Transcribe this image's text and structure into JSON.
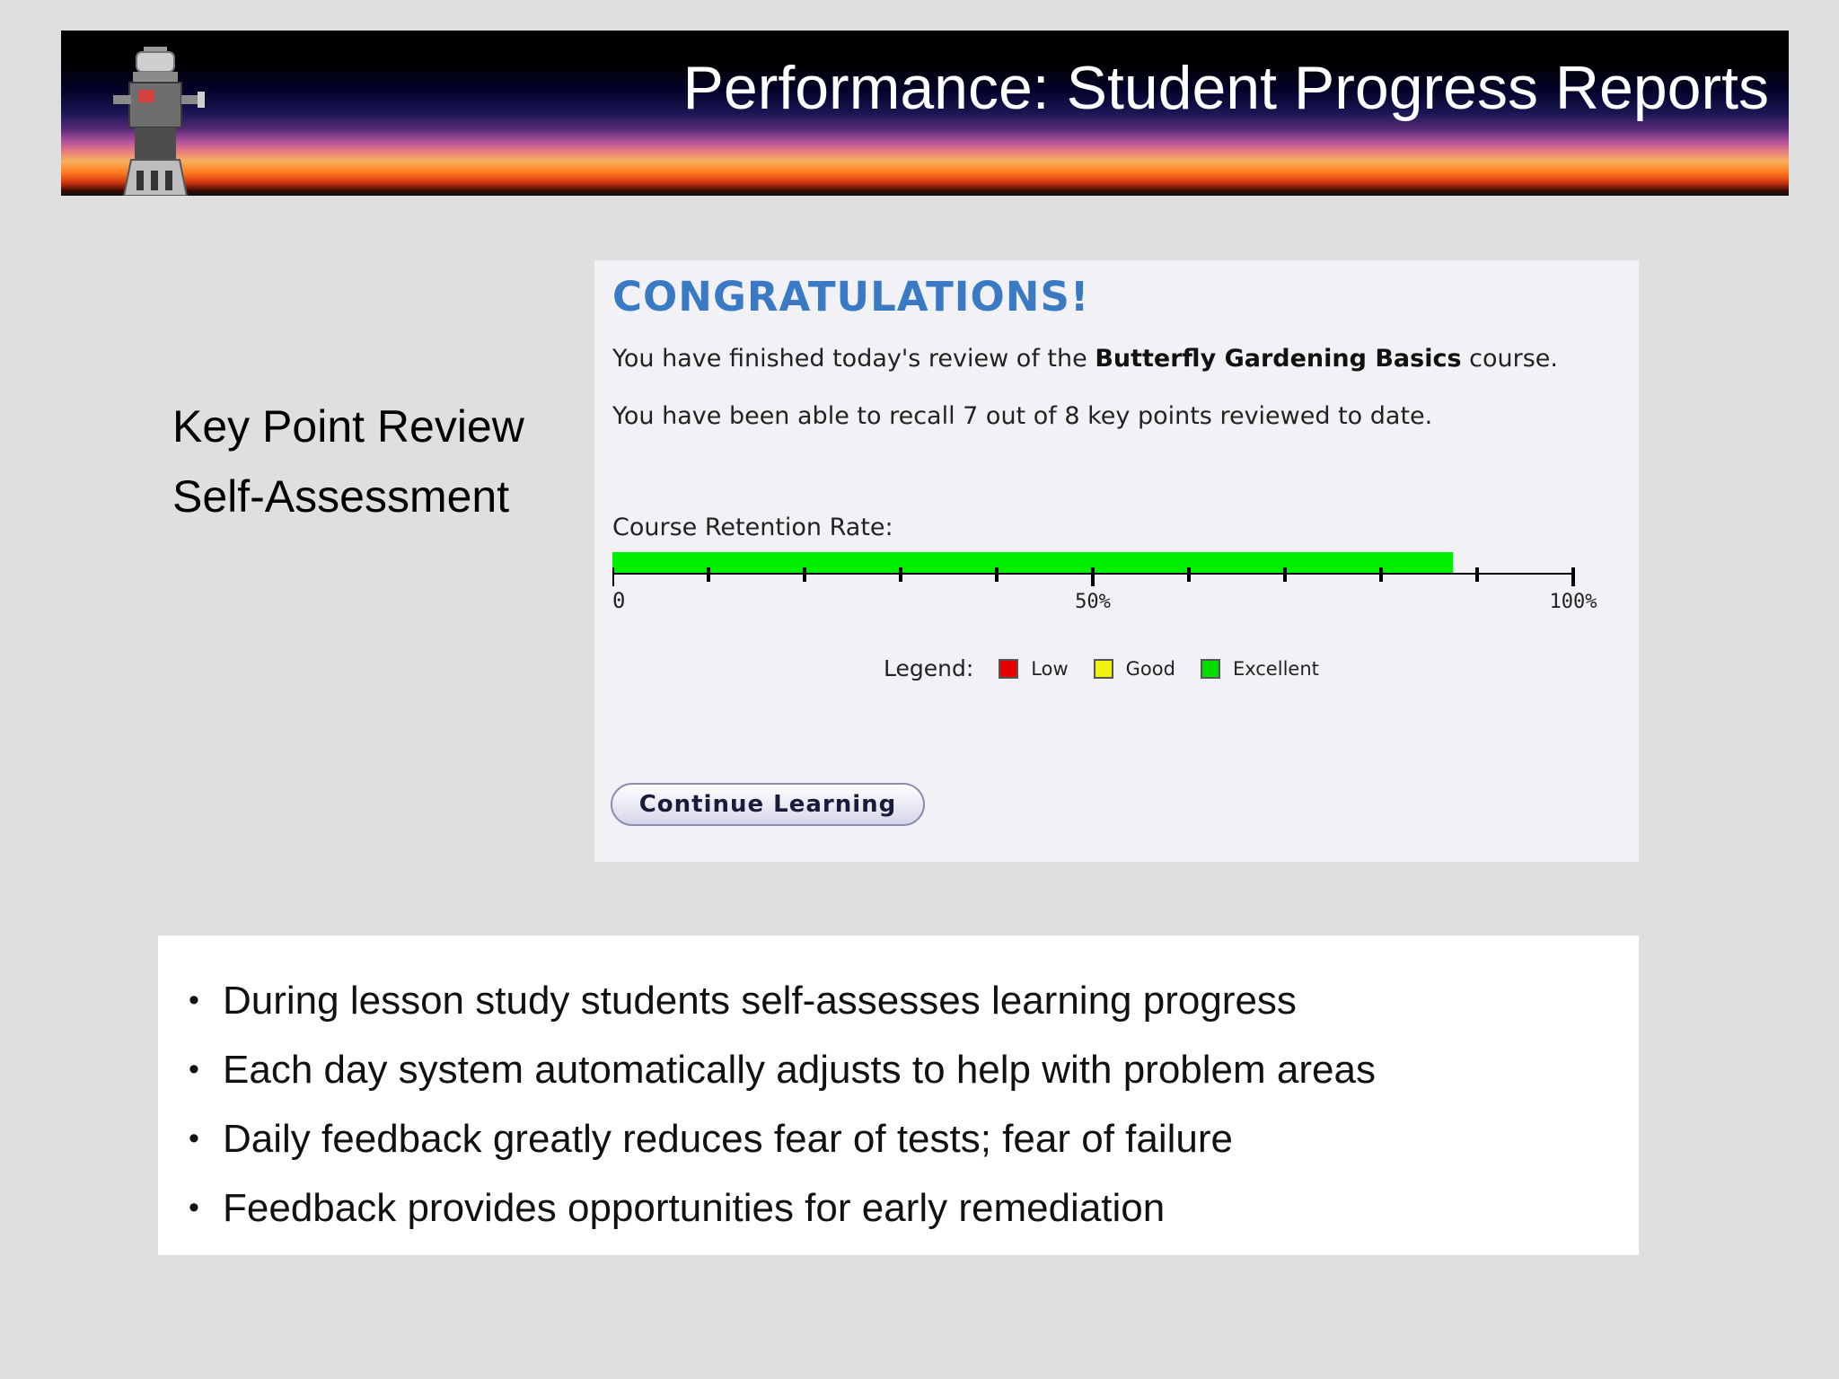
{
  "header": {
    "title": "Performance: Student Progress Reports"
  },
  "side_labels": {
    "line1": "Key Point Review",
    "line2": "Self-Assessment"
  },
  "panel": {
    "heading": "CONGRATULATIONS!",
    "finished_prefix": "You have finished today's review of the ",
    "course_name": "Butterfly Gardening Basics",
    "finished_suffix": " course.",
    "recall_text": "You have been able to recall 7 out of 8 key points reviewed to date.",
    "retention_label": "Course Retention Rate:",
    "retention_rate": 0.875,
    "bar_color": "#00ee00",
    "scale_labels": {
      "min": "0",
      "mid": "50%",
      "max": "100%"
    },
    "legend": {
      "label": "Legend:",
      "items": [
        {
          "label": "Low",
          "color": "#e60000"
        },
        {
          "label": "Good",
          "color": "#f2f20f"
        },
        {
          "label": "Excellent",
          "color": "#00dd00"
        }
      ]
    },
    "continue_button": "Continue Learning"
  },
  "bullets": [
    "During lesson study students self-assesses learning progress",
    "Each day system automatically adjusts to help with problem areas",
    "Daily feedback greatly reduces fear of tests; fear of failure",
    "Feedback provides opportunities for early remediation"
  ]
}
